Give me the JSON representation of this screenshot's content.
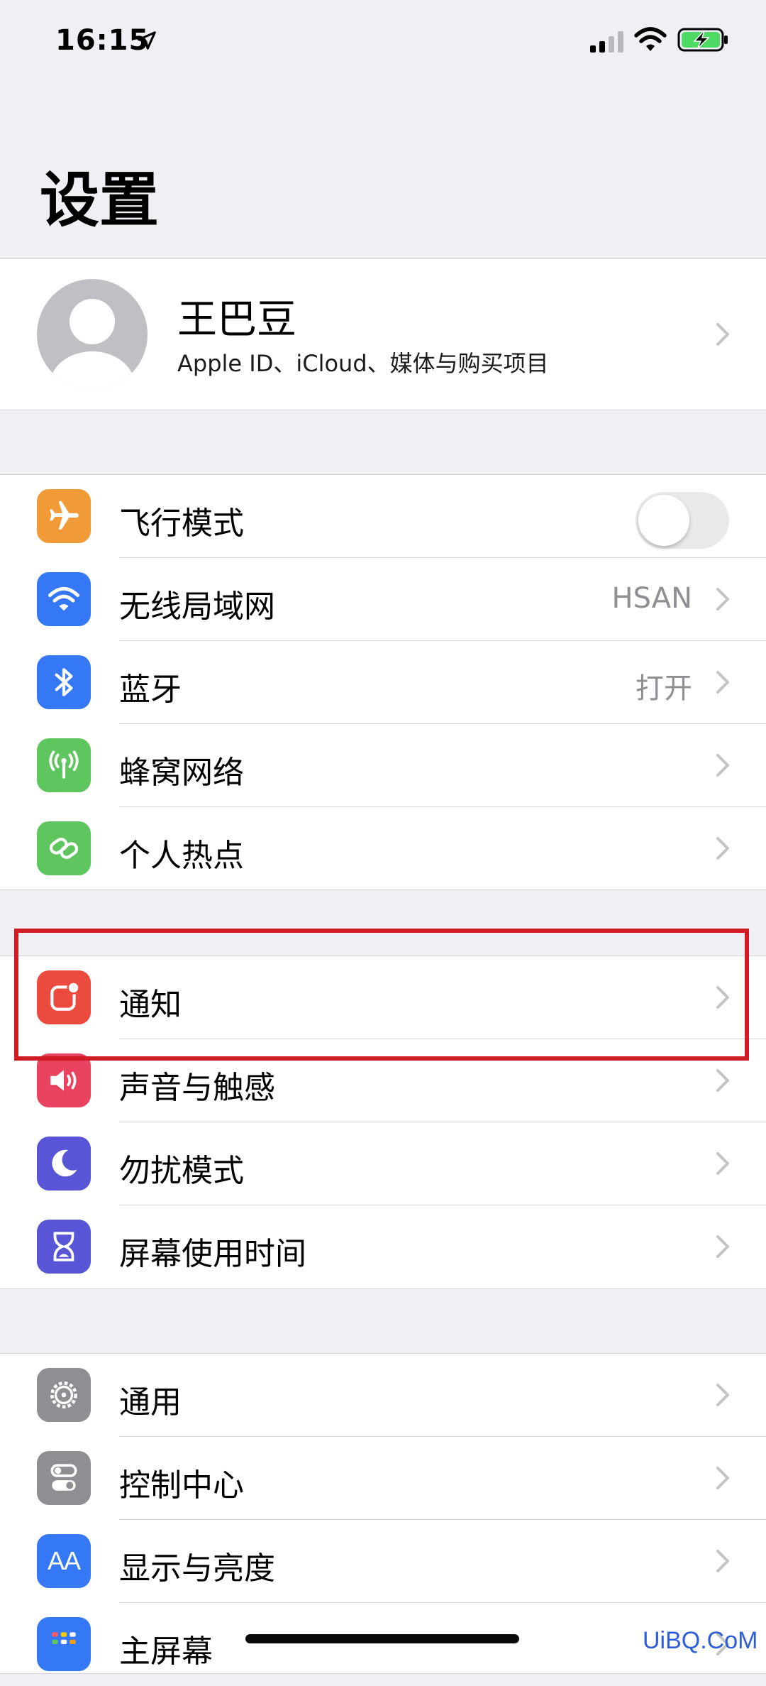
{
  "status_bar": {
    "time": "16:15"
  },
  "header": {
    "title": "设置"
  },
  "profile": {
    "name": "王巴豆",
    "subtitle": "Apple ID、iCloud、媒体与购买项目"
  },
  "group1": [
    {
      "label": "飞行模式",
      "icon": "airplane-icon",
      "color": "#f19a38",
      "control": "toggle",
      "toggle_on": false
    },
    {
      "label": "无线局域网",
      "icon": "wifi-icon",
      "color": "#3478f6",
      "value": "HSAN"
    },
    {
      "label": "蓝牙",
      "icon": "bluetooth-icon",
      "color": "#3478f6",
      "value": "打开"
    },
    {
      "label": "蜂窝网络",
      "icon": "cellular-icon",
      "color": "#5fc65f"
    },
    {
      "label": "个人热点",
      "icon": "hotspot-icon",
      "color": "#5fc65f"
    }
  ],
  "group2": [
    {
      "label": "通知",
      "icon": "notifications-icon",
      "color": "#eb4b3f"
    },
    {
      "label": "声音与触感",
      "icon": "sound-icon",
      "color": "#ea4360"
    },
    {
      "label": "勿扰模式",
      "icon": "moon-icon",
      "color": "#5856d6"
    },
    {
      "label": "屏幕使用时间",
      "icon": "hourglass-icon",
      "color": "#5856d6"
    }
  ],
  "group3": [
    {
      "label": "通用",
      "icon": "gear-icon",
      "color": "#8e8e93"
    },
    {
      "label": "控制中心",
      "icon": "switches-icon",
      "color": "#8e8e93"
    },
    {
      "label": "显示与亮度",
      "icon": "display-icon",
      "color": "#3478f6",
      "icon_text": "AA"
    },
    {
      "label": "主屏幕",
      "icon": "home-screen-icon",
      "color": "#3478f6"
    }
  ],
  "watermark": "UiBQ.CoM"
}
